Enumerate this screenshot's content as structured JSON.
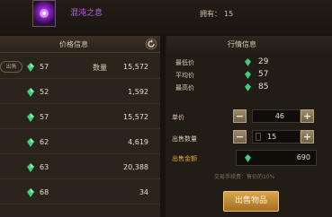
{
  "item": {
    "name": "混沌之息",
    "owned_label": "拥有：",
    "owned_count": "15",
    "icon": "purple-orb-icon"
  },
  "price_panel": {
    "title": "价格信息",
    "sell_tag": "出售",
    "qty_label": "数量",
    "rows": [
      {
        "price": "57",
        "qty": "15,572"
      },
      {
        "price": "52",
        "qty": "1,592"
      },
      {
        "price": "57",
        "qty": "15,572"
      },
      {
        "price": "62",
        "qty": "4,619"
      },
      {
        "price": "63",
        "qty": "20,388"
      },
      {
        "price": "68",
        "qty": "34"
      }
    ]
  },
  "market_panel": {
    "title": "行情信息",
    "min_label": "最低价",
    "min_value": "29",
    "avg_label": "平均价",
    "avg_value": "57",
    "max_label": "最高价",
    "max_value": "85"
  },
  "sell_form": {
    "unit_price_label": "单价",
    "unit_price": "46",
    "quantity_label": "出售数量",
    "quantity": "15",
    "total_label": "出售金额",
    "total": "690",
    "fee_note": "交易手续费：售价的10%",
    "sell_button": "出售物品",
    "minus": "−",
    "plus": "+"
  },
  "colors": {
    "gem": "#3fcf7a",
    "accent": "#dba54a",
    "item_name": "#b067e8",
    "total_label": "#e0a63c"
  }
}
